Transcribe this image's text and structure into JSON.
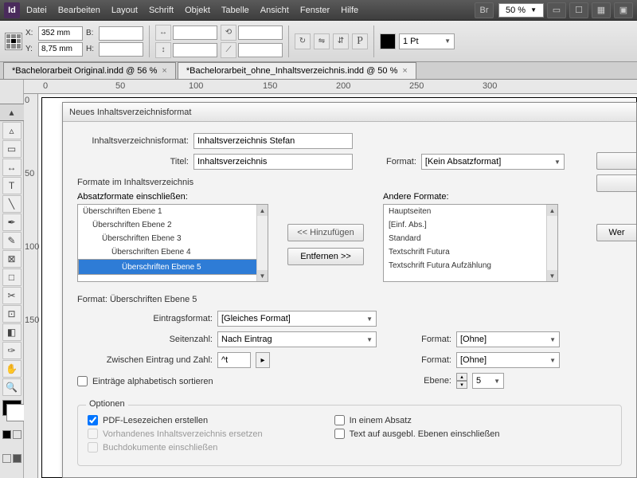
{
  "app": {
    "logo": "Id"
  },
  "menu": [
    "Datei",
    "Bearbeiten",
    "Layout",
    "Schrift",
    "Objekt",
    "Tabelle",
    "Ansicht",
    "Fenster",
    "Hilfe"
  ],
  "menubar_right": {
    "br_label": "Br",
    "zoom": "50 %"
  },
  "control": {
    "x_label": "X:",
    "x_value": "352 mm",
    "y_label": "Y:",
    "y_value": "8,75 mm",
    "b_label": "B:",
    "b_value": "",
    "h_label": "H:",
    "h_value": "",
    "stroke": "1 Pt"
  },
  "tabs": [
    {
      "label": "*Bachelorarbeit Original.indd @ 56 %",
      "active": false
    },
    {
      "label": "*Bachelorarbeit_ohne_Inhaltsverzeichnis.indd @ 50 %",
      "active": true
    }
  ],
  "ruler_h": [
    "0",
    "50",
    "100",
    "150",
    "200",
    "250",
    "300"
  ],
  "ruler_v": [
    "0",
    "50",
    "100",
    "150"
  ],
  "dialog": {
    "title": "Neues Inhaltsverzeichnisformat",
    "format_name_label": "Inhaltsverzeichnisformat:",
    "format_name_value": "Inhaltsverzeichnis Stefan",
    "title_label": "Titel:",
    "title_value": "Inhaltsverzeichnis",
    "title_format_label": "Format:",
    "title_format_value": "[Kein Absatzformat]",
    "group1_label": "Formate im Inhaltsverzeichnis",
    "include_label": "Absatzformate einschließen:",
    "other_label": "Andere Formate:",
    "include_items": [
      "Überschriften Ebene 1",
      "Überschriften Ebene 2",
      "Überschriften Ebene 3",
      "Überschriften Ebene 4",
      "Überschriften Ebene 5"
    ],
    "include_selected": 4,
    "other_items": [
      "Hauptseiten",
      "[Einf. Abs.]",
      "Standard",
      "Textschrift Futura",
      "Textschrift Futura Aufzählung"
    ],
    "add_btn": "<< Hinzufügen",
    "remove_btn": "Entfernen >>",
    "weniger_btn": "Wer",
    "selected_format_label": "Format: Überschriften Ebene 5",
    "entry_format_label": "Eintragsformat:",
    "entry_format_value": "[Gleiches Format]",
    "page_num_label": "Seitenzahl:",
    "page_num_value": "Nach Eintrag",
    "page_num_format_label": "Format:",
    "page_num_format_value": "[Ohne]",
    "between_label": "Zwischen Eintrag und Zahl:",
    "between_value": "^t",
    "between_format_label": "Format:",
    "between_format_value": "[Ohne]",
    "alpha_sort": "Einträge alphabetisch sortieren",
    "level_label": "Ebene:",
    "level_value": "5",
    "options_label": "Optionen",
    "opt_pdf": "PDF-Lesezeichen erstellen",
    "opt_in_para": "In einem Absatz",
    "opt_replace": "Vorhandenes Inhaltsverzeichnis ersetzen",
    "opt_hidden": "Text auf ausgebl. Ebenen einschließen",
    "opt_book": "Buchdokumente einschließen"
  }
}
